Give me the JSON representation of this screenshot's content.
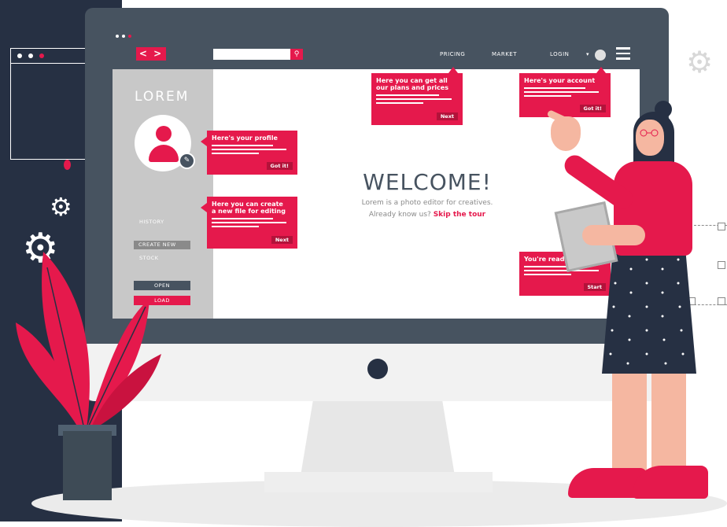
{
  "colors": {
    "accent": "#e5194c",
    "dark": "#263043",
    "monitor": "#475360",
    "sidebar": "#c8c8c8"
  },
  "topbar": {
    "nav_arrows": "< >",
    "search_placeholder": "",
    "links": [
      "PRICING",
      "MARKET",
      "LOGIN"
    ]
  },
  "sidebar": {
    "title": "LOREM",
    "history": "HISTORY",
    "create_new": "CREATE NEW",
    "stock": "STOCK",
    "open": "OPEN",
    "load": "LOAD"
  },
  "main": {
    "welcome": "WELCOME!",
    "tagline": "Lorem is a photo editor for creatives.",
    "already": "Already know us?",
    "skip": "Skip the tour"
  },
  "tips": {
    "profile": {
      "title": "Here's your profile",
      "button": "Got it!"
    },
    "create": {
      "title_line1": "Here you can create",
      "title_line2": "a new file for editing",
      "button": "Next"
    },
    "plans": {
      "title_line1": "Here you can get all",
      "title_line2": "our plans and prices",
      "button": "Next"
    },
    "account": {
      "title": "Here's your account",
      "button": "Got it!"
    },
    "ready": {
      "title": "You're ready!",
      "button": "Start"
    }
  },
  "icons": [
    "gear-icon",
    "search-icon",
    "menu-icon",
    "pencil-icon",
    "user-icon"
  ]
}
